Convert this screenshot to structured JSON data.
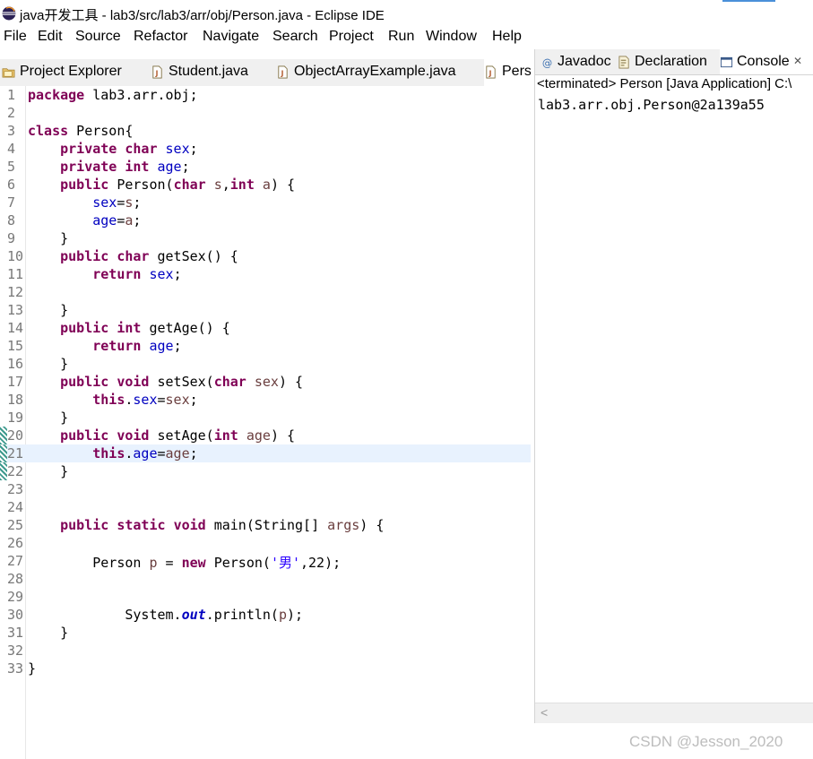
{
  "window": {
    "title": "java开发工具 - lab3/src/lab3/arr/obj/Person.java - Eclipse IDE"
  },
  "menu": [
    "File",
    "Edit",
    "Source",
    "Refactor",
    "Navigate",
    "Search",
    "Project",
    "Run",
    "Window",
    "Help"
  ],
  "editor_tabs": [
    {
      "label": "Project Explorer",
      "icon": "folder-icon"
    },
    {
      "label": "Student.java",
      "icon": "java-file-icon"
    },
    {
      "label": "ObjectArrayExample.java",
      "icon": "java-file-icon"
    },
    {
      "label": "Person.java",
      "icon": "java-file-icon",
      "active": true
    }
  ],
  "editor": {
    "current_line": 21,
    "change_marker_lines": [
      20,
      21,
      22
    ],
    "lines": [
      {
        "n": "1",
        "html": "<span class='kw'>package</span> lab3.arr.obj;"
      },
      {
        "n": "2",
        "html": ""
      },
      {
        "n": "3",
        "html": "<span class='kw'>class</span> Person{"
      },
      {
        "n": "4",
        "html": "    <span class='kw'>private</span> <span class='kw'>char</span> <span class='fld'>sex</span>;"
      },
      {
        "n": "5",
        "html": "    <span class='kw'>private</span> <span class='kw'>int</span> <span class='fld'>age</span>;"
      },
      {
        "n": "6",
        "html": "    <span class='kw'>public</span> Person(<span class='kw'>char</span> <span class='var'>s</span>,<span class='kw'>int</span> <span class='var'>a</span>) {"
      },
      {
        "n": "7",
        "html": "        <span class='fld'>sex</span>=<span class='var'>s</span>;"
      },
      {
        "n": "8",
        "html": "        <span class='fld'>age</span>=<span class='var'>a</span>;"
      },
      {
        "n": "9",
        "html": "    }"
      },
      {
        "n": "10",
        "html": "    <span class='kw'>public</span> <span class='kw'>char</span> getSex() {"
      },
      {
        "n": "11",
        "html": "        <span class='kw'>return</span> <span class='fld'>sex</span>;"
      },
      {
        "n": "12",
        "html": ""
      },
      {
        "n": "13",
        "html": "    }"
      },
      {
        "n": "14",
        "html": "    <span class='kw'>public</span> <span class='kw'>int</span> getAge() {"
      },
      {
        "n": "15",
        "html": "        <span class='kw'>return</span> <span class='fld'>age</span>;"
      },
      {
        "n": "16",
        "html": "    }"
      },
      {
        "n": "17",
        "html": "    <span class='kw'>public</span> <span class='kw'>void</span> setSex(<span class='kw'>char</span> <span class='var'>sex</span>) {"
      },
      {
        "n": "18",
        "html": "        <span class='kw'>this</span>.<span class='fld'>sex</span>=<span class='var'>sex</span>;"
      },
      {
        "n": "19",
        "html": "    }"
      },
      {
        "n": "20",
        "html": "    <span class='kw'>public</span> <span class='kw'>void</span> setAge(<span class='kw'>int</span> <span class='var'>age</span>) {"
      },
      {
        "n": "21",
        "html": "        <span class='kw'>this</span>.<span class='fld'>age</span>=<span class='var'>age</span>;"
      },
      {
        "n": "22",
        "html": "    }"
      },
      {
        "n": "23",
        "html": ""
      },
      {
        "n": "24",
        "html": ""
      },
      {
        "n": "25",
        "html": "    <span class='kw'>public</span> <span class='kw'>static</span> <span class='kw'>void</span> main(String[] <span class='var'>args</span>) {"
      },
      {
        "n": "26",
        "html": ""
      },
      {
        "n": "27",
        "html": "        Person <span class='var'>p</span> = <span class='kw'>new</span> Person(<span class='str'>'男'</span>,22);"
      },
      {
        "n": "28",
        "html": ""
      },
      {
        "n": "29",
        "html": ""
      },
      {
        "n": "30",
        "html": "            System.<span class='sfld'>out</span>.println(<span class='var'>p</span>);"
      },
      {
        "n": "31",
        "html": "    }"
      },
      {
        "n": "32",
        "html": ""
      },
      {
        "n": "33",
        "html": "}"
      }
    ]
  },
  "right_tabs": [
    {
      "label": "Javadoc",
      "icon": "javadoc-icon"
    },
    {
      "label": "Declaration",
      "icon": "declaration-icon"
    },
    {
      "label": "Console",
      "icon": "console-icon",
      "active": true,
      "close": "✕"
    }
  ],
  "console": {
    "header": "<terminated> Person [Java Application] C:\\",
    "output": "lab3.arr.obj.Person@2a139a55"
  },
  "scroll_arrow": "<",
  "watermark": "CSDN @Jesson_2020"
}
